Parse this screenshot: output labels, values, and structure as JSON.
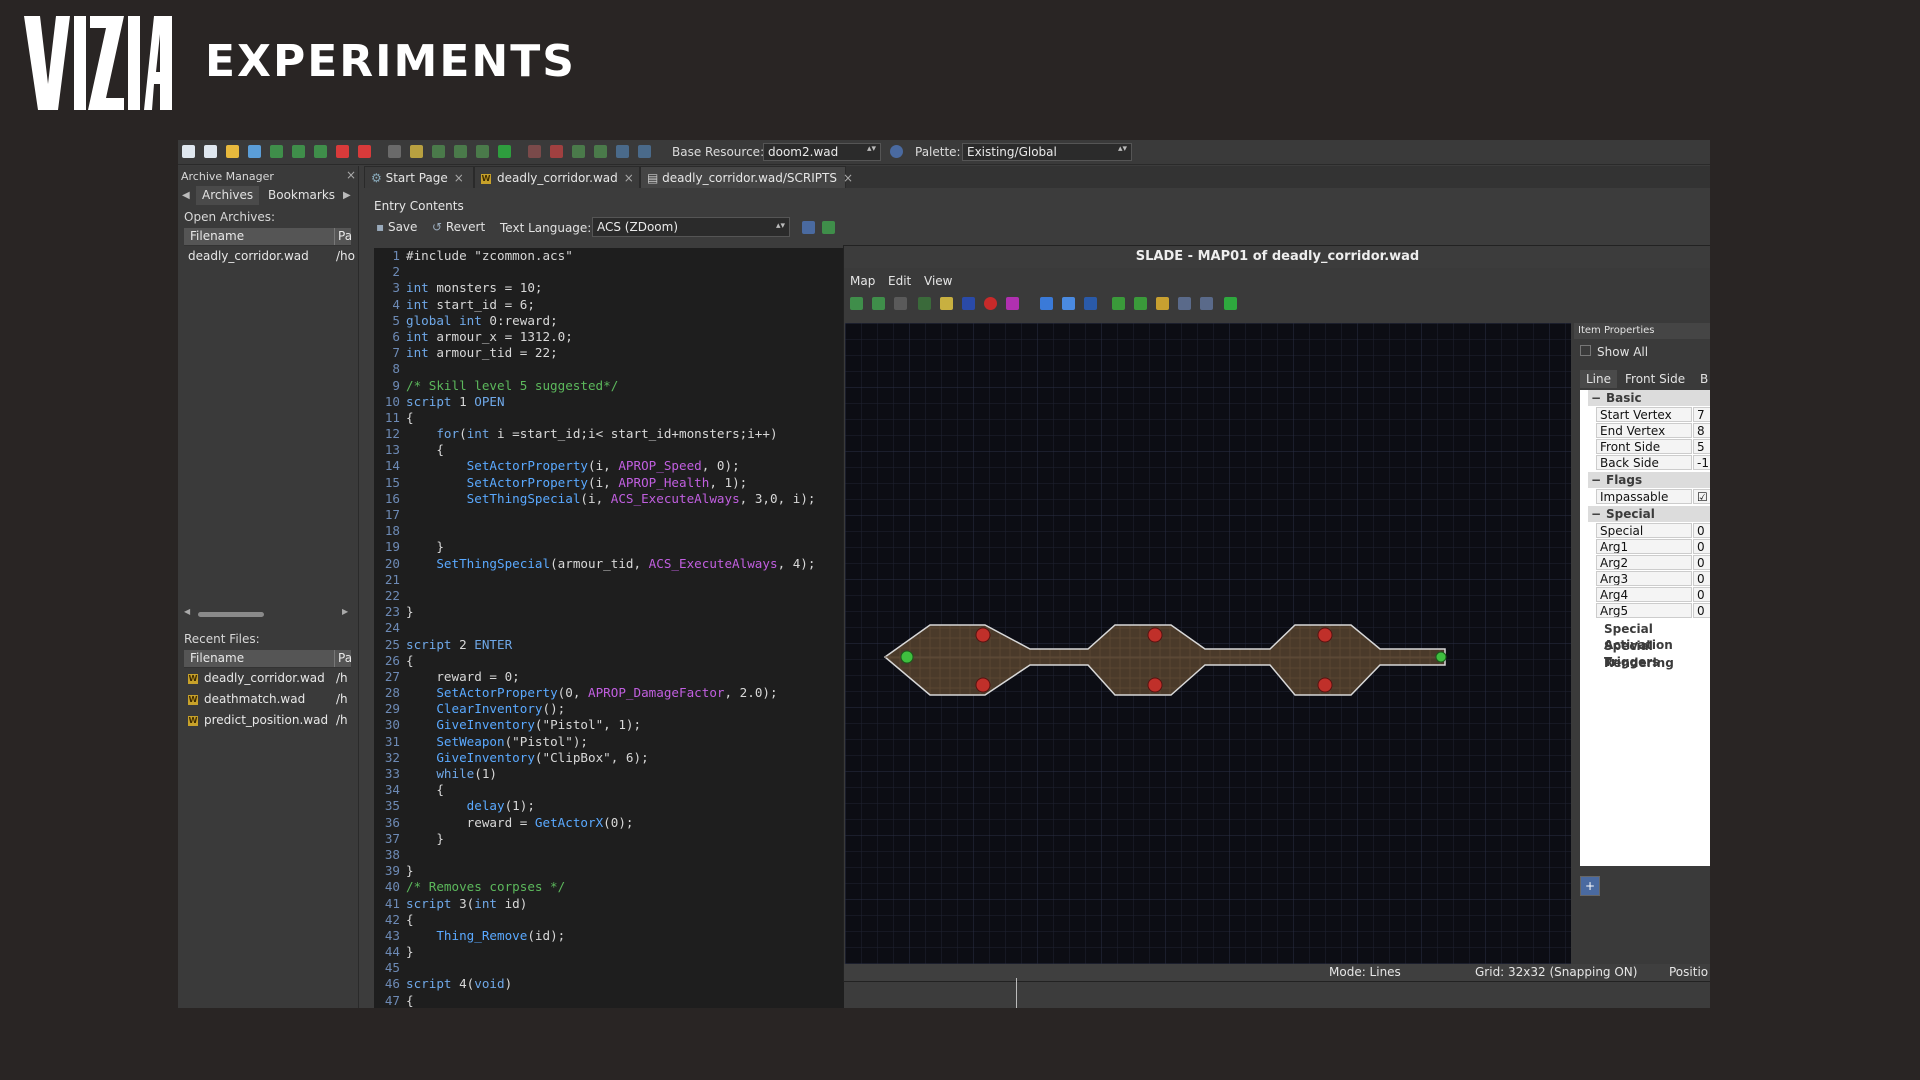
{
  "header": {
    "logo_text": "VIZIA",
    "title": "EXPERIMENTS"
  },
  "toolbar": {
    "base_resource_label": "Base Resource:",
    "base_resource_value": "doom2.wad",
    "palette_label": "Palette:",
    "palette_value": "Existing/Global"
  },
  "archive_manager": {
    "title": "Archive Manager",
    "tabs": [
      "Archives",
      "Bookmarks"
    ],
    "open_archives_label": "Open Archives:",
    "open_header": {
      "filename": "Filename",
      "path": "Pa"
    },
    "open_files": [
      {
        "name": "deadly_corridor.wad",
        "path": "/ho"
      }
    ],
    "recent_label": "Recent Files:",
    "recent_header": {
      "filename": "Filename",
      "path": "Pa"
    },
    "recent_files": [
      {
        "name": "deadly_corridor.wad",
        "path": "/h"
      },
      {
        "name": "deathmatch.wad",
        "path": "/h"
      },
      {
        "name": "predict_position.wad",
        "path": "/h"
      }
    ]
  },
  "tabs": [
    {
      "label": "Start Page"
    },
    {
      "label": "deadly_corridor.wad"
    },
    {
      "label": "deadly_corridor.wad/SCRIPTS"
    }
  ],
  "editor": {
    "entry_title": "Entry Contents",
    "save_label": "Save",
    "revert_label": "Revert",
    "language_label": "Text Language:",
    "language_value": "ACS (ZDoom)"
  },
  "code_lines": [
    [
      [
        "pp",
        "#include \"zcommon.acs\""
      ]
    ],
    [],
    [
      [
        "kw",
        "int"
      ],
      [
        "tx",
        " monsters = 10;"
      ]
    ],
    [
      [
        "kw",
        "int"
      ],
      [
        "tx",
        " start_id = 6;"
      ]
    ],
    [
      [
        "kw",
        "global"
      ],
      [
        "tx",
        " "
      ],
      [
        "kw",
        "int"
      ],
      [
        "tx",
        " 0:reward;"
      ]
    ],
    [
      [
        "kw",
        "int"
      ],
      [
        "tx",
        " armour_x = 1312.0;"
      ]
    ],
    [
      [
        "kw",
        "int"
      ],
      [
        "tx",
        " armour_tid = 22;"
      ]
    ],
    [],
    [
      [
        "cm",
        "/* Skill level 5 suggested*/"
      ]
    ],
    [
      [
        "kw",
        "script"
      ],
      [
        "tx",
        " 1 "
      ],
      [
        "kw",
        "OPEN"
      ]
    ],
    [
      [
        "tx",
        "{"
      ]
    ],
    [
      [
        "tx",
        "    "
      ],
      [
        "kw",
        "for"
      ],
      [
        "tx",
        "("
      ],
      [
        "kw",
        "int"
      ],
      [
        "tx",
        " i =start_id;i< start_id+monsters;i++)"
      ]
    ],
    [
      [
        "tx",
        "    {"
      ]
    ],
    [
      [
        "tx",
        "        "
      ],
      [
        "fn",
        "SetActorProperty"
      ],
      [
        "tx",
        "(i, "
      ],
      [
        "cst",
        "APROP_Speed"
      ],
      [
        "tx",
        ", 0);"
      ]
    ],
    [
      [
        "tx",
        "        "
      ],
      [
        "fn",
        "SetActorProperty"
      ],
      [
        "tx",
        "(i, "
      ],
      [
        "cst",
        "APROP_Health"
      ],
      [
        "tx",
        ", 1);"
      ]
    ],
    [
      [
        "tx",
        "        "
      ],
      [
        "fn",
        "SetThingSpecial"
      ],
      [
        "tx",
        "(i, "
      ],
      [
        "cst",
        "ACS_ExecuteAlways"
      ],
      [
        "tx",
        ", 3,0, i);"
      ]
    ],
    [],
    [],
    [
      [
        "tx",
        "    }"
      ]
    ],
    [
      [
        "tx",
        "    "
      ],
      [
        "fn",
        "SetThingSpecial"
      ],
      [
        "tx",
        "(armour_tid, "
      ],
      [
        "cst",
        "ACS_ExecuteAlways"
      ],
      [
        "tx",
        ", 4);"
      ]
    ],
    [],
    [],
    [
      [
        "tx",
        "}"
      ]
    ],
    [],
    [
      [
        "kw",
        "script"
      ],
      [
        "tx",
        " 2 "
      ],
      [
        "kw",
        "ENTER"
      ]
    ],
    [
      [
        "tx",
        "{"
      ]
    ],
    [
      [
        "tx",
        "    reward = 0;"
      ]
    ],
    [
      [
        "tx",
        "    "
      ],
      [
        "fn",
        "SetActorProperty"
      ],
      [
        "tx",
        "(0, "
      ],
      [
        "cst",
        "APROP_DamageFactor"
      ],
      [
        "tx",
        ", 2.0);"
      ]
    ],
    [
      [
        "tx",
        "    "
      ],
      [
        "fn",
        "ClearInventory"
      ],
      [
        "tx",
        "();"
      ]
    ],
    [
      [
        "tx",
        "    "
      ],
      [
        "fn",
        "GiveInventory"
      ],
      [
        "tx",
        "(\"Pistol\", 1);"
      ]
    ],
    [
      [
        "tx",
        "    "
      ],
      [
        "fn",
        "SetWeapon"
      ],
      [
        "tx",
        "(\"Pistol\");"
      ]
    ],
    [
      [
        "tx",
        "    "
      ],
      [
        "fn",
        "GiveInventory"
      ],
      [
        "tx",
        "(\"ClipBox\", 6);"
      ]
    ],
    [
      [
        "tx",
        "    "
      ],
      [
        "kw",
        "while"
      ],
      [
        "tx",
        "(1)"
      ]
    ],
    [
      [
        "tx",
        "    {"
      ]
    ],
    [
      [
        "tx",
        "        "
      ],
      [
        "fn",
        "delay"
      ],
      [
        "tx",
        "(1);"
      ]
    ],
    [
      [
        "tx",
        "        reward = "
      ],
      [
        "fn",
        "GetActorX"
      ],
      [
        "tx",
        "(0);"
      ]
    ],
    [
      [
        "tx",
        "    }"
      ]
    ],
    [],
    [
      [
        "tx",
        "}"
      ]
    ],
    [
      [
        "cm",
        "/* Removes corpses */"
      ]
    ],
    [
      [
        "kw",
        "script"
      ],
      [
        "tx",
        " 3("
      ],
      [
        "kw",
        "int"
      ],
      [
        "tx",
        " id)"
      ]
    ],
    [
      [
        "tx",
        "{"
      ]
    ],
    [
      [
        "tx",
        "    "
      ],
      [
        "fn",
        "Thing_Remove"
      ],
      [
        "tx",
        "(id);"
      ]
    ],
    [
      [
        "tx",
        "}"
      ]
    ],
    [],
    [
      [
        "kw",
        "script"
      ],
      [
        "tx",
        " 4("
      ],
      [
        "kw",
        "void"
      ],
      [
        "tx",
        ")"
      ]
    ],
    [
      [
        "tx",
        "{"
      ]
    ]
  ],
  "map_window": {
    "title": "SLADE - MAP01 of deadly_corridor.wad",
    "menu": [
      "Map",
      "Edit",
      "View"
    ],
    "status_mode": "Mode: Lines",
    "status_grid": "Grid: 32x32 (Snapping ON)",
    "status_pos": "Positio"
  },
  "item_properties": {
    "title": "Item Properties",
    "show_all": "Show All",
    "tabs": [
      "Line",
      "Front Side",
      "B"
    ],
    "groups": {
      "basic": "Basic",
      "flags": "Flags",
      "special": "Special"
    },
    "basic_rows": [
      {
        "key": "Start Vertex",
        "val": "7"
      },
      {
        "key": "End Vertex",
        "val": "8"
      },
      {
        "key": "Front Side",
        "val": "5"
      },
      {
        "key": "Back Side",
        "val": "-1"
      }
    ],
    "flag_rows": [
      {
        "key": "Impassable",
        "val": "☑"
      }
    ],
    "special_rows": [
      {
        "key": "Special",
        "val": "0"
      },
      {
        "key": "Arg1",
        "val": "0"
      },
      {
        "key": "Arg2",
        "val": "0"
      },
      {
        "key": "Arg3",
        "val": "0"
      },
      {
        "key": "Arg4",
        "val": "0"
      },
      {
        "key": "Arg5",
        "val": "0"
      }
    ],
    "sub_groups": [
      "Special Activation",
      "Special Triggers",
      "Rendering"
    ]
  },
  "colors": {
    "background": "#292524",
    "map_floor": "#4a3a2a",
    "monster": "#c0302a",
    "player_marker": "#3fbf3f"
  }
}
